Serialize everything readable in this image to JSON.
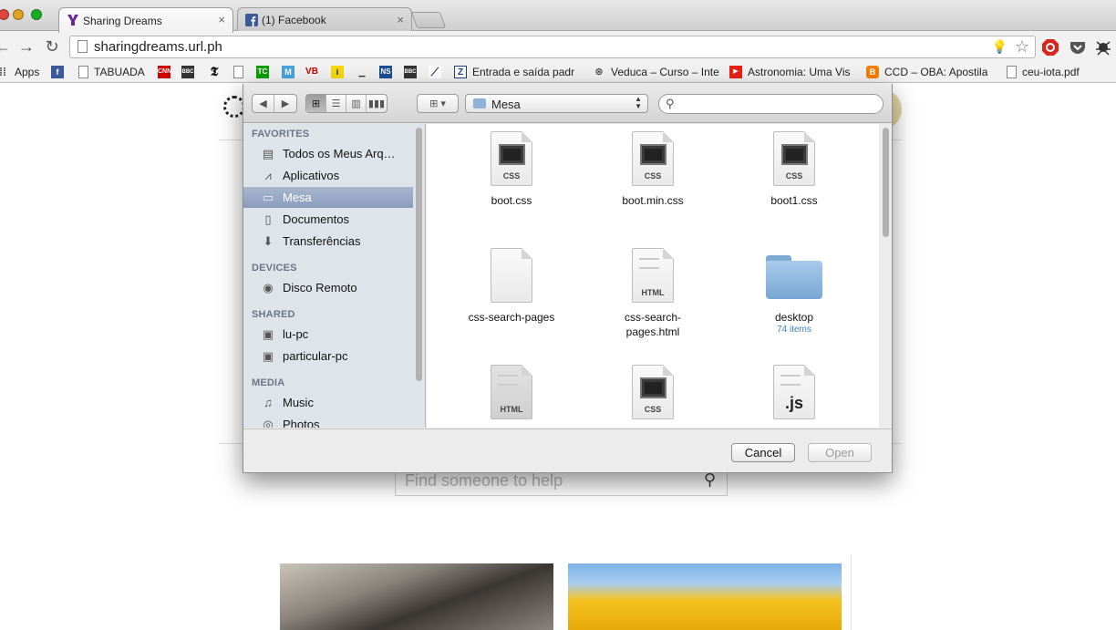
{
  "browser": {
    "tabs": [
      {
        "label": "Sharing Dreams",
        "close": "×"
      },
      {
        "label": "(1) Facebook",
        "close": "×"
      }
    ],
    "url": "sharingdreams.url.ph",
    "bookmarks": [
      {
        "label": "Apps",
        "icon": "apps-grid-icon"
      },
      {
        "label": "",
        "icon": "facebook-icon"
      },
      {
        "label": "TABUADA",
        "icon": "page-icon"
      },
      {
        "label": "",
        "icon": "cnn-icon"
      },
      {
        "label": "",
        "icon": "bbc-icon"
      },
      {
        "label": "",
        "icon": "nytimes-icon"
      },
      {
        "label": "",
        "icon": "page-icon"
      },
      {
        "label": "",
        "icon": "techcrunch-icon"
      },
      {
        "label": "",
        "icon": "m-icon"
      },
      {
        "label": "",
        "icon": "vb-icon"
      },
      {
        "label": "",
        "icon": "i-icon"
      },
      {
        "label": "",
        "icon": "device-icon"
      },
      {
        "label": "",
        "icon": "ns-icon"
      },
      {
        "label": "",
        "icon": "bbc-icon"
      },
      {
        "label": "",
        "icon": "chart-icon"
      },
      {
        "label": "Entrada e saída padr",
        "icon": "z-icon"
      },
      {
        "label": "Veduca – Curso – Inte",
        "icon": "veduca-icon"
      },
      {
        "label": "Astronomia: Uma Vis",
        "icon": "youtube-icon"
      },
      {
        "label": "CCD – OBA: Apostila",
        "icon": "blogger-icon"
      },
      {
        "label": "ceu-iota.pdf",
        "icon": "page-icon"
      }
    ]
  },
  "page": {
    "search_placeholder": "Find someone to help"
  },
  "dialog": {
    "location": "Mesa",
    "search_placeholder": "",
    "sidebar": {
      "sections": [
        {
          "title": "FAVORITES",
          "items": [
            {
              "label": "Todos os Meus Arq…",
              "icon": "all-files-icon",
              "selected": false
            },
            {
              "label": "Aplicativos",
              "icon": "applications-icon",
              "selected": false
            },
            {
              "label": "Mesa",
              "icon": "desktop-icon",
              "selected": true
            },
            {
              "label": "Documentos",
              "icon": "documents-icon",
              "selected": false
            },
            {
              "label": "Transferências",
              "icon": "downloads-icon",
              "selected": false
            }
          ]
        },
        {
          "title": "DEVICES",
          "items": [
            {
              "label": "Disco Remoto",
              "icon": "remote-disc-icon",
              "selected": false
            }
          ]
        },
        {
          "title": "SHARED",
          "items": [
            {
              "label": "lu-pc",
              "icon": "computer-icon",
              "selected": false
            },
            {
              "label": "particular-pc",
              "icon": "computer-icon",
              "selected": false
            }
          ]
        },
        {
          "title": "MEDIA",
          "items": [
            {
              "label": "Music",
              "icon": "music-icon",
              "selected": false
            },
            {
              "label": "Photos",
              "icon": "photos-icon",
              "selected": false
            }
          ]
        }
      ]
    },
    "files": [
      {
        "name": "boot.css",
        "kind": "css",
        "tag": "CSS",
        "sub": ""
      },
      {
        "name": "boot.min.css",
        "kind": "css",
        "tag": "CSS",
        "sub": ""
      },
      {
        "name": "boot1.css",
        "kind": "css",
        "tag": "CSS",
        "sub": ""
      },
      {
        "name": "css-search-pages",
        "kind": "blank",
        "tag": "",
        "sub": ""
      },
      {
        "name": "css-search-\npages.html",
        "kind": "html",
        "tag": "HTML",
        "sub": ""
      },
      {
        "name": "desktop",
        "kind": "folder",
        "tag": "",
        "sub": "74 items"
      },
      {
        "name": "",
        "kind": "html-gray",
        "tag": "HTML",
        "sub": ""
      },
      {
        "name": "",
        "kind": "css",
        "tag": "CSS",
        "sub": ""
      },
      {
        "name": "",
        "kind": "js",
        "tag": ".js",
        "sub": ""
      }
    ],
    "buttons": {
      "cancel": "Cancel",
      "open": "Open"
    }
  }
}
